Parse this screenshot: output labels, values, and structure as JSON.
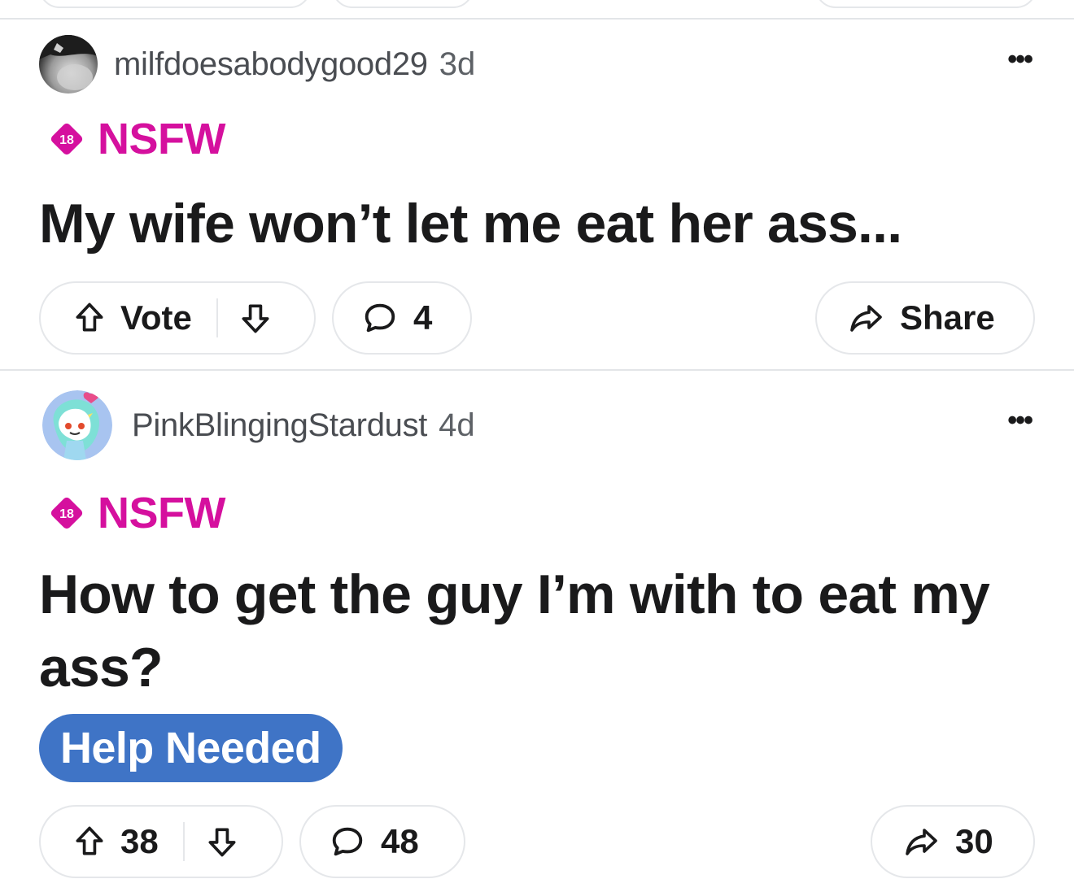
{
  "posts": [
    {
      "username": "milfdoesabodygood29",
      "age": "3d",
      "nsfw_badge": "18",
      "nsfw_label": "NSFW",
      "title": "My wife won’t let me eat her ass...",
      "flair": "",
      "vote_label": "Vote",
      "comment_count": "4",
      "share_label": "Share",
      "more_icon": "more-horizontal-icon"
    },
    {
      "username": "PinkBlingingStardust",
      "age": "4d",
      "nsfw_badge": "18",
      "nsfw_label": "NSFW",
      "title": "How to get the guy I’m with to eat my ass?",
      "flair": "Help Needed",
      "vote_label": "38",
      "comment_count": "48",
      "share_label": "30",
      "more_icon": "more-horizontal-icon"
    }
  ],
  "colors": {
    "nsfw": "#d5109e",
    "flair_bg": "#3f74c6",
    "border": "#e5e7ea",
    "text": "#1a1a1b"
  }
}
